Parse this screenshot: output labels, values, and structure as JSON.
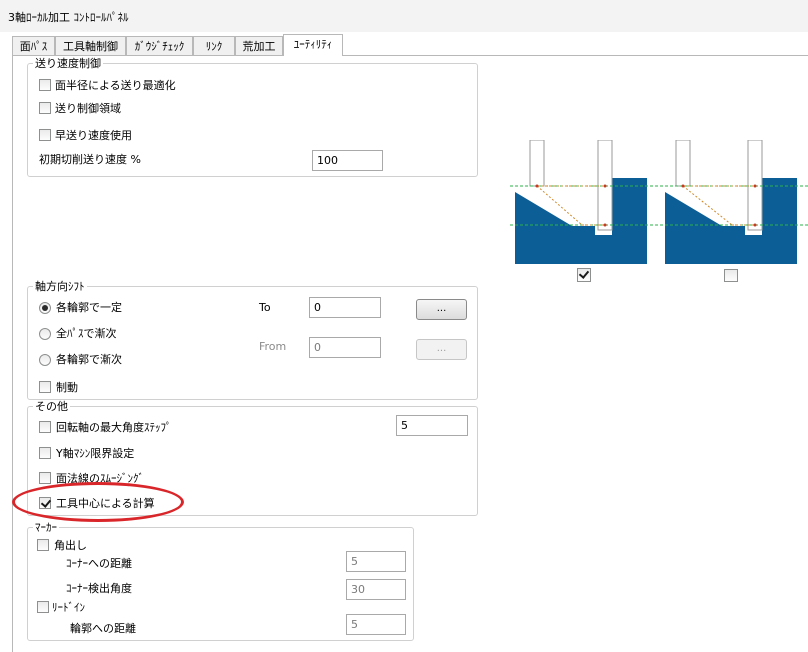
{
  "window": {
    "title": "3軸ﾛｰｶﾙ加工 ｺﾝﾄﾛｰﾙﾊﾟﾈﾙ"
  },
  "tabs": [
    {
      "label": "面ﾊﾟｽ",
      "active": false
    },
    {
      "label": "工具軸制御",
      "active": false
    },
    {
      "label": "ｶﾞｳｼﾞﾁｪｯｸ",
      "active": false
    },
    {
      "label": "ﾘﾝｸ",
      "active": false
    },
    {
      "label": "荒加工",
      "active": false
    },
    {
      "label": "ﾕｰﾃｨﾘﾃｨ",
      "active": true
    }
  ],
  "feed": {
    "title": "送り速度制御",
    "radius_opt": {
      "label": "面半径による送り最適化",
      "checked": false
    },
    "feed_area": {
      "label": "送り制御領域",
      "checked": false
    },
    "rapid": {
      "label": "早送り速度使用",
      "checked": false
    },
    "initial_label": "初期切削送り速度 %",
    "initial_value": "100"
  },
  "shift": {
    "title": "軸方向ｼﾌﾄ",
    "constant": {
      "label": "各輪郭で一定",
      "checked": true
    },
    "all_pass": {
      "label": "全ﾊﾟｽで漸次",
      "checked": false
    },
    "each_gradual": {
      "label": "各輪郭で漸次",
      "checked": false
    },
    "control": {
      "label": "制動",
      "checked": false
    },
    "to_label": "To",
    "to_value": "0",
    "to_button": "...",
    "from_label": "From",
    "from_value": "0",
    "from_button": "..."
  },
  "other": {
    "title": "その他",
    "max_angle": {
      "label": "回転軸の最大角度ｽﾃｯﾌﾟ",
      "checked": false,
      "value": "5"
    },
    "y_limit": {
      "label": "Y軸ﾏｼﾝ限界設定",
      "checked": false
    },
    "surface_normal": {
      "label": "面法線のｽﾑｰｼﾞﾝｸﾞ",
      "checked": false
    },
    "tool_center": {
      "label": "工具中心による計算",
      "checked": true
    }
  },
  "marker": {
    "title": "ﾏｰｶｰ",
    "corner": {
      "label": "角出し",
      "checked": false
    },
    "corner_dist_label": "ｺｰﾅｰへの距離",
    "corner_dist_value": "5",
    "corner_angle_label": "ｺｰﾅｰ検出角度",
    "corner_angle_value": "30",
    "lead_in": {
      "label": "ﾘｰﾄﾞｲﾝ",
      "checked": false
    },
    "contour_dist_label": "輪郭への距離",
    "contour_dist_value": "5"
  },
  "preview": {
    "left_checked": true,
    "right_checked": false,
    "colors": {
      "material": "#0b5e96",
      "tool": "#ffffff",
      "green_line": "#2fb34a",
      "path": "#d08a2b"
    }
  }
}
